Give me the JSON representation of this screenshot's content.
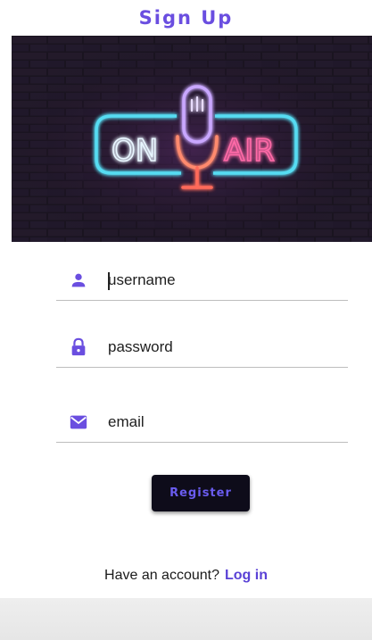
{
  "title": "Sign Up",
  "banner": {
    "left_text": "ON",
    "right_text": "AIR"
  },
  "form": {
    "username": {
      "placeholder": "username",
      "icon": "person-icon",
      "value": ""
    },
    "password": {
      "placeholder": "password",
      "icon": "lock-icon",
      "value": ""
    },
    "email": {
      "placeholder": "email",
      "icon": "mail-icon",
      "value": ""
    }
  },
  "register_label": "Register",
  "footer": {
    "prompt": "Have an account?",
    "link": "Log in"
  },
  "colors": {
    "accent": "#6a4ee0",
    "button_bg": "#0e0c1a",
    "neon_cyan": "#4fd8f0",
    "neon_pink": "#ff4d9d"
  }
}
